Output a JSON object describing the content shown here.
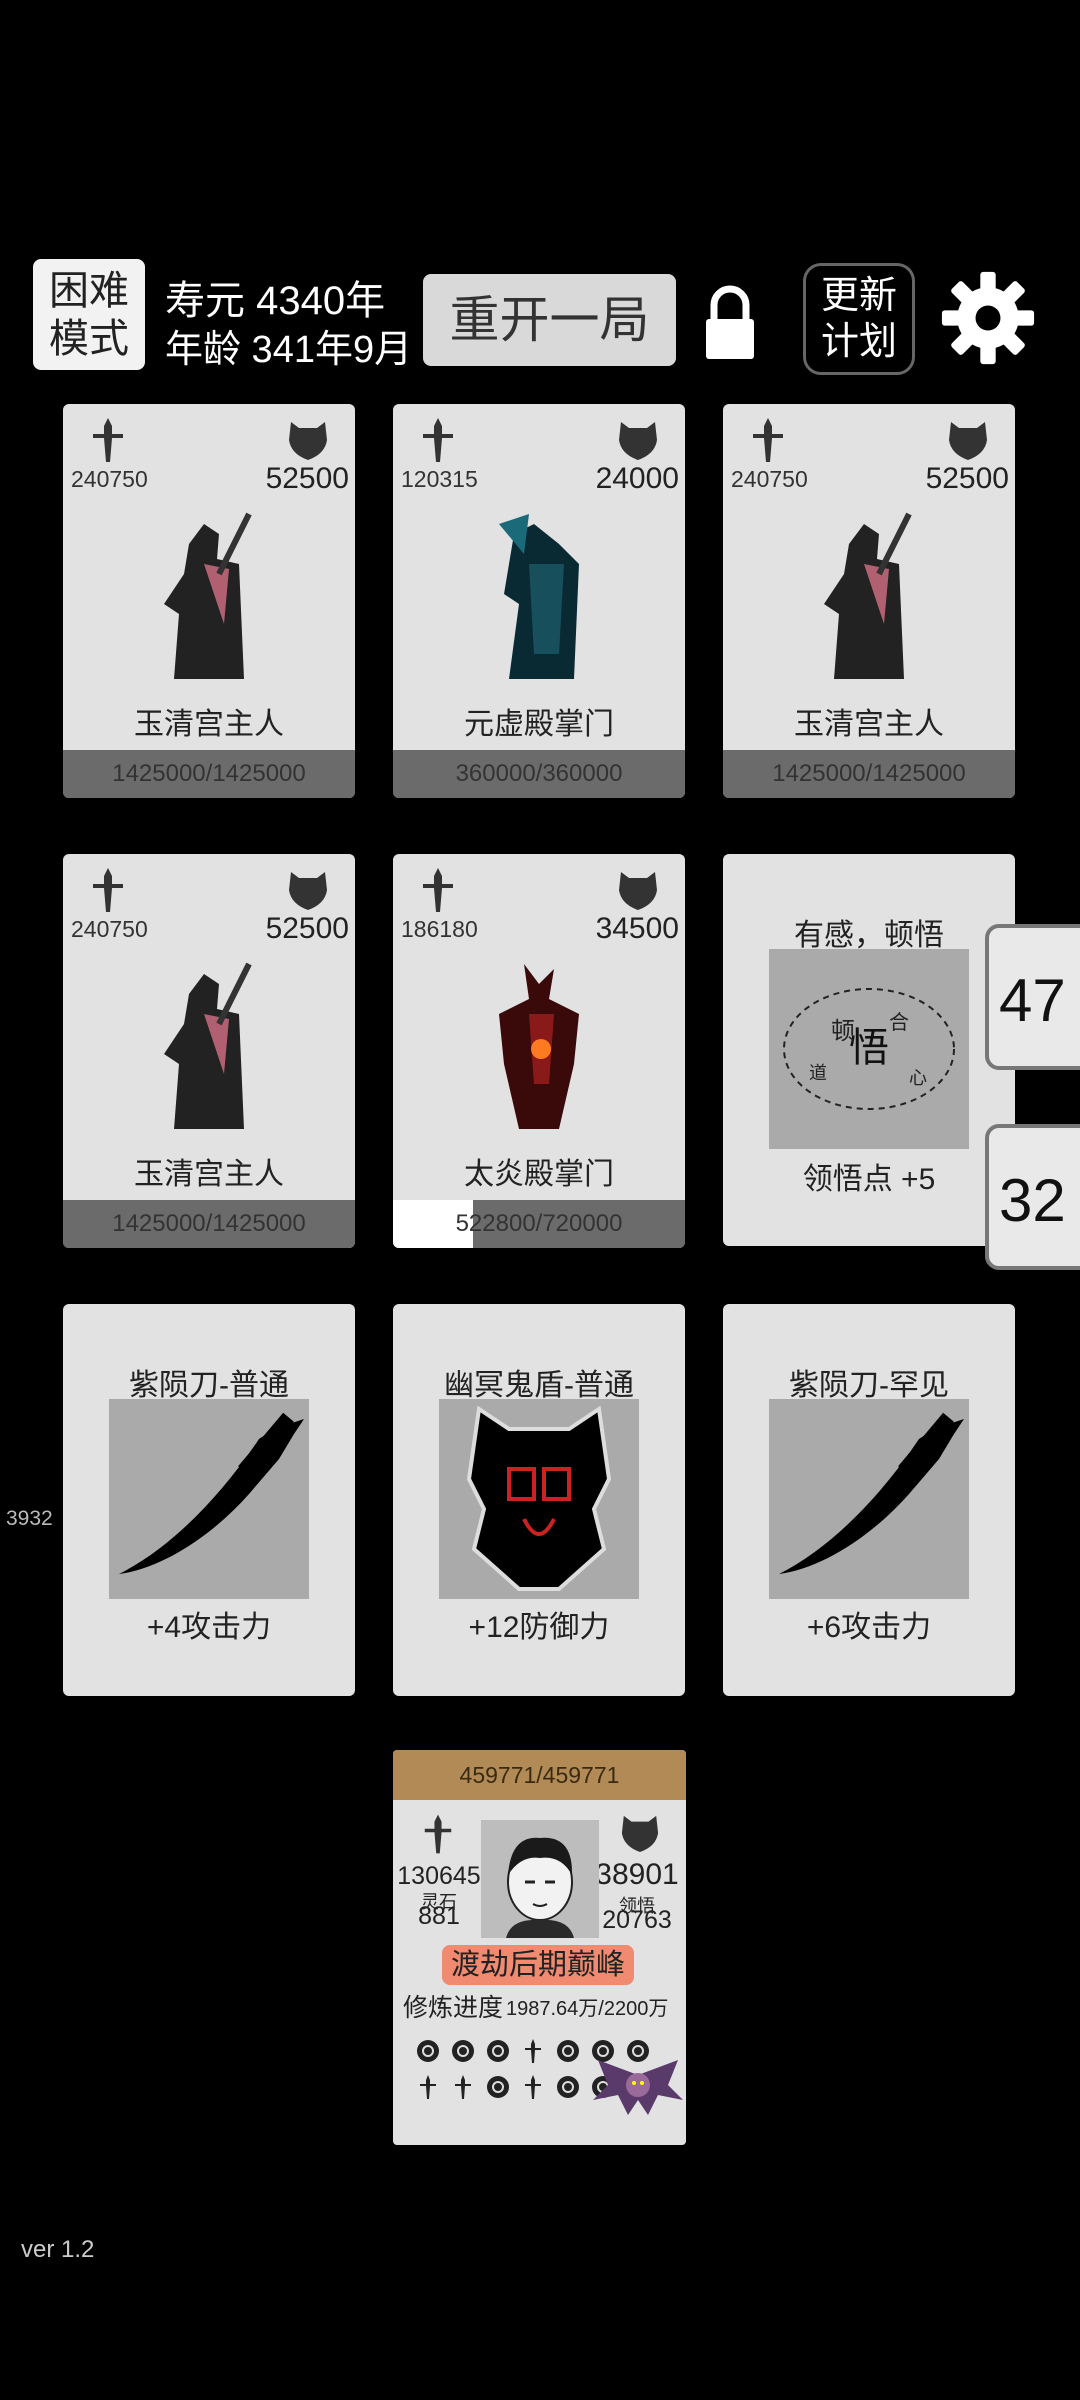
{
  "header": {
    "mode_label": "困难\n模式",
    "lifespan": "寿元 4340年",
    "age": "年龄 341年9月",
    "restart_label": "重开一局",
    "update_label": "更新\n计划"
  },
  "enemies": [
    {
      "atk": "240750",
      "def": "52500",
      "name": "玉清宫主人",
      "hp": "1425000/1425000",
      "hp_frac": 1.0
    },
    {
      "atk": "120315",
      "def": "24000",
      "name": "元虚殿掌门",
      "hp": "360000/360000",
      "hp_frac": 1.0
    },
    {
      "atk": "240750",
      "def": "52500",
      "name": "玉清宫主人",
      "hp": "1425000/1425000",
      "hp_frac": 1.0
    },
    {
      "atk": "240750",
      "def": "52500",
      "name": "玉清宫主人",
      "hp": "1425000/1425000",
      "hp_frac": 1.0
    },
    {
      "atk": "186180",
      "def": "34500",
      "name": "太炎殿掌门",
      "hp": "522800/720000",
      "hp_frac": 0.726
    }
  ],
  "insight_card": {
    "title": "有感，顿悟",
    "stat": "领悟点  +5"
  },
  "items": [
    {
      "title": "紫陨刀-普通",
      "stat": "+4攻击力"
    },
    {
      "title": "幽冥鬼盾-普通",
      "stat": "+12防御力"
    },
    {
      "title": "紫陨刀-罕见",
      "stat": "+6攻击力"
    }
  ],
  "side_buttons": [
    "47",
    "32"
  ],
  "left_counter": "3932",
  "player": {
    "hp": "459771/459771",
    "atk": "130645",
    "def": "38901",
    "spirit_stone_label": "灵石",
    "spirit_stone": "881",
    "insight_label": "领悟",
    "insight": "20763",
    "realm": "渡劫后期巅峰",
    "progress_label": "修炼进度",
    "progress": "1987.64万/2200万"
  },
  "version": "ver 1.2"
}
